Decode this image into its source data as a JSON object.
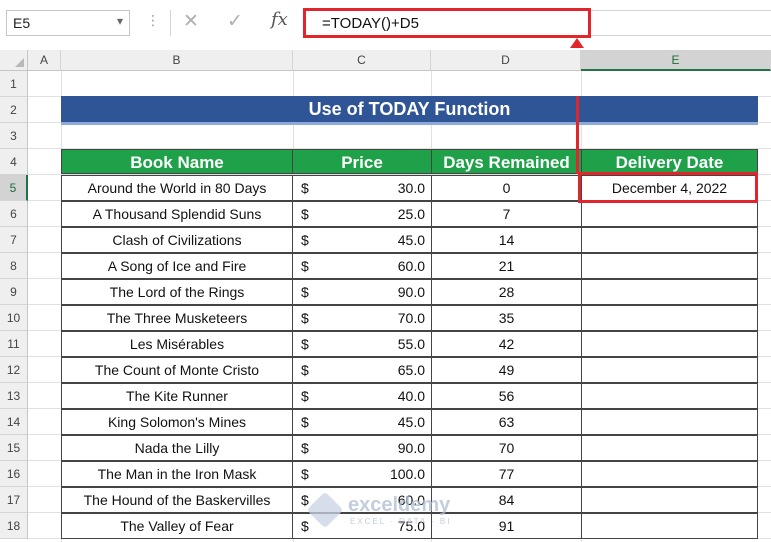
{
  "formula_bar": {
    "name_box": "E5",
    "cancel_icon": "✕",
    "enter_icon": "✓",
    "fx_label": "fx",
    "formula": "=TODAY()+D5"
  },
  "columns": [
    "A",
    "B",
    "C",
    "D",
    "E"
  ],
  "selected_column": "E",
  "rows": [
    "1",
    "2",
    "3",
    "4",
    "5",
    "6",
    "7",
    "8",
    "9",
    "10",
    "11",
    "12",
    "13",
    "14",
    "15",
    "16",
    "17",
    "18"
  ],
  "selected_row": "5",
  "title": "Use of TODAY Function",
  "table": {
    "headers": [
      "Book Name",
      "Price",
      "Days Remained",
      "Delivery Date"
    ],
    "currency_symbol": "$",
    "rows": [
      {
        "name": "Around the World in 80 Days",
        "price": "30.0",
        "days": "0",
        "delivery": "December 4, 2022"
      },
      {
        "name": "A Thousand Splendid Suns",
        "price": "25.0",
        "days": "7",
        "delivery": ""
      },
      {
        "name": "Clash of Civilizations",
        "price": "45.0",
        "days": "14",
        "delivery": ""
      },
      {
        "name": "A Song of Ice and Fire",
        "price": "60.0",
        "days": "21",
        "delivery": ""
      },
      {
        "name": "The Lord of the Rings",
        "price": "90.0",
        "days": "28",
        "delivery": ""
      },
      {
        "name": "The Three Musketeers",
        "price": "70.0",
        "days": "35",
        "delivery": ""
      },
      {
        "name": "Les Misérables",
        "price": "55.0",
        "days": "42",
        "delivery": ""
      },
      {
        "name": "The Count of Monte Cristo",
        "price": "65.0",
        "days": "49",
        "delivery": ""
      },
      {
        "name": "The Kite Runner",
        "price": "40.0",
        "days": "56",
        "delivery": ""
      },
      {
        "name": "King Solomon's Mines",
        "price": "45.0",
        "days": "63",
        "delivery": ""
      },
      {
        "name": "Nada the Lilly",
        "price": "90.0",
        "days": "70",
        "delivery": ""
      },
      {
        "name": "The Man in the Iron Mask",
        "price": "100.0",
        "days": "77",
        "delivery": ""
      },
      {
        "name": "The Hound of the Baskervilles",
        "price": "60.0",
        "days": "84",
        "delivery": ""
      },
      {
        "name": "The Valley of Fear",
        "price": "75.0",
        "days": "91",
        "delivery": ""
      }
    ]
  },
  "watermark": {
    "brand": "exceldemy",
    "sub": "EXCEL · DATA · BI"
  },
  "colors": {
    "title_bg": "#2f5597",
    "header_bg": "#1fa14a",
    "highlight": "#e0262b"
  }
}
